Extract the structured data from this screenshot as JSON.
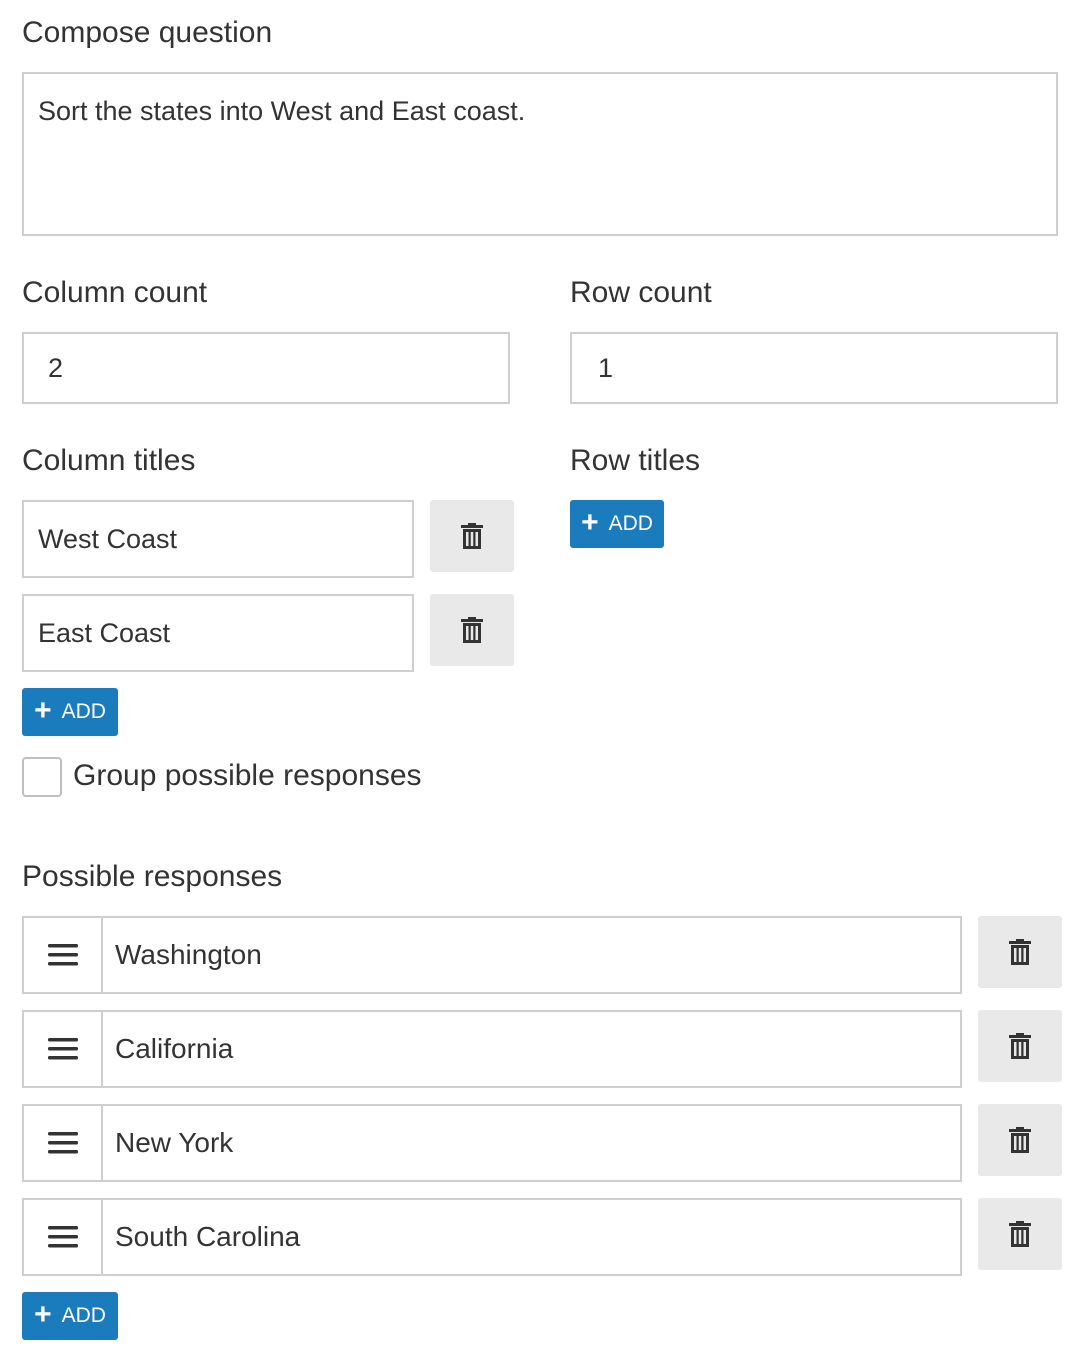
{
  "compose": {
    "label": "Compose question",
    "value": "Sort the states into West and East coast."
  },
  "column_count": {
    "label": "Column count",
    "value": "2"
  },
  "row_count": {
    "label": "Row count",
    "value": "1"
  },
  "column_titles": {
    "label": "Column titles",
    "items": [
      "West Coast",
      "East Coast"
    ],
    "add_label": "ADD"
  },
  "row_titles": {
    "label": "Row titles",
    "add_label": "ADD"
  },
  "group_responses": {
    "label": "Group possible responses",
    "checked": false
  },
  "possible_responses": {
    "label": "Possible responses",
    "items": [
      "Washington",
      "California",
      "New York",
      "South Carolina"
    ],
    "add_label": "ADD"
  },
  "colors": {
    "accent": "#1a7bbd",
    "button_gray": "#e9e9e9",
    "border": "#cfcfcf"
  },
  "icons": {
    "delete": "trash-icon",
    "drag": "drag-handle-icon",
    "add": "plus-icon"
  }
}
